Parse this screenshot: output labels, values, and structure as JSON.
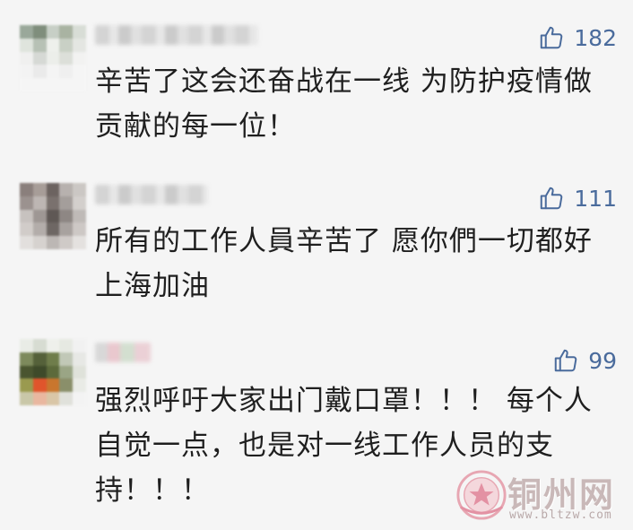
{
  "comments": [
    {
      "likes": "182",
      "lines": [
        "辛苦了这会还奋战在一线 为防护疫情做",
        "贡献的每一位！"
      ]
    },
    {
      "likes": "111",
      "lines": [
        "所有的工作人員辛苦了  愿你們一切都好",
        "上海加油"
      ]
    },
    {
      "likes": "99",
      "lines": [
        "强烈呼吁大家出门戴口罩！！！ 每个人",
        "自觉一点，也是对一线工作人员的支",
        "持！！！"
      ]
    }
  ],
  "watermark": {
    "name": "铜州网",
    "url": "www.bltzw.com",
    "color": "#c9b8b8"
  },
  "colors": {
    "like": "#4a6b9c",
    "text": "#1f1f1f",
    "background": "#f5f5f5"
  },
  "icons": {
    "like": "thumbs-up-icon"
  }
}
